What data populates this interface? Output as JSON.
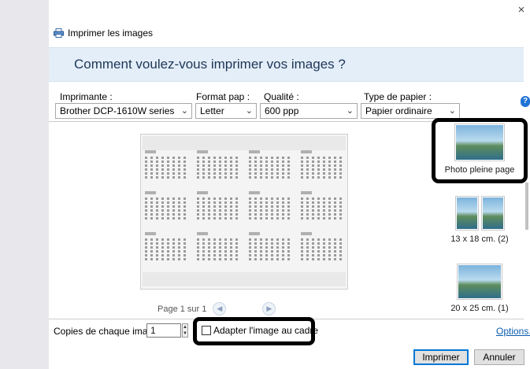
{
  "window": {
    "title": "Imprimer les images",
    "close_glyph": "×",
    "banner": "Comment voulez-vous imprimer vos images ?"
  },
  "fields": {
    "printer": {
      "label": "Imprimante :",
      "value": "Brother DCP-1610W series"
    },
    "paper_format": {
      "label": "Format pap :",
      "value": "Letter"
    },
    "quality": {
      "label": "Qualité :",
      "value": "600 ppp"
    },
    "paper_type": {
      "label": "Type de papier :",
      "value": "Papier ordinaire"
    }
  },
  "help_glyph": "?",
  "preview": {
    "pager_text": "Page 1 sur 1",
    "prev_glyph": "◀",
    "next_glyph": "▶"
  },
  "layouts": [
    {
      "label": "Photo pleine page",
      "selected": true
    },
    {
      "label": "13 x 18 cm. (2)",
      "selected": false
    },
    {
      "label": "20 x 25 cm. (1)",
      "selected": false
    }
  ],
  "footer": {
    "copies_label": "Copies de chaque image :",
    "copies_value": "1",
    "spin_up": "▲",
    "spin_down": "▼",
    "fit_label": "Adapter l'image au cadre",
    "fit_checked": false,
    "options_link": "Options..."
  },
  "buttons": {
    "print": "Imprimer",
    "cancel": "Annuler"
  },
  "colors": {
    "banner_bg": "#e4eef8",
    "banner_text": "#1d3657",
    "link": "#0b5cad",
    "primary_border": "#0078d7",
    "highlight_outline": "#000000"
  },
  "icons": [
    "printer-icon",
    "close-icon",
    "help-icon",
    "chevron-down-icon",
    "prev-page-icon",
    "next-page-icon",
    "spin-up-icon",
    "spin-down-icon"
  ]
}
